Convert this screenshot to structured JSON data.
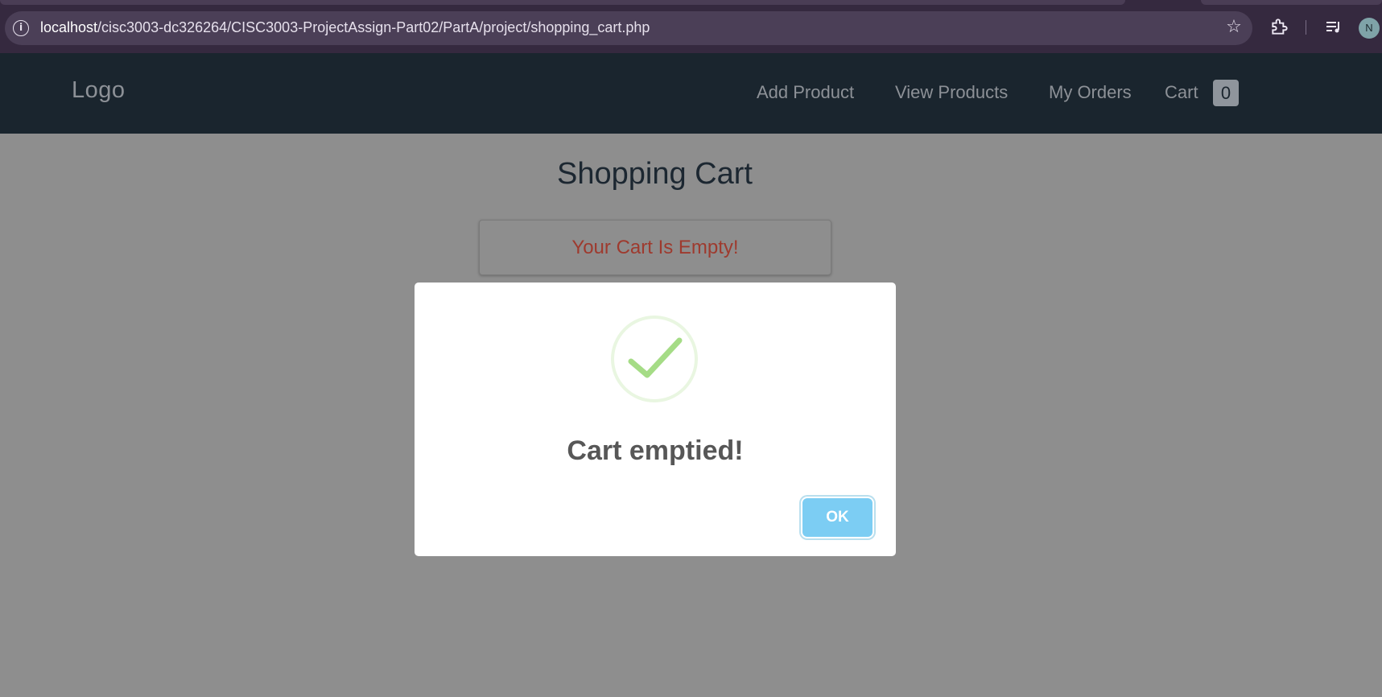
{
  "browser": {
    "url_host": "localhost",
    "url_path": "/cisc3003-dc326264/CISC3003-ProjectAssign-Part02/PartA/project/shopping_cart.php",
    "profile_initial": "N"
  },
  "navbar": {
    "logo": "Logo",
    "links": [
      "Add Product",
      "View Products",
      "My Orders",
      "Cart"
    ],
    "cart_count": "0"
  },
  "page": {
    "title": "Shopping Cart",
    "empty_message": "Your Cart Is Empty!"
  },
  "modal": {
    "title": "Cart emptied!",
    "ok_label": "OK",
    "icon": "success-check-icon"
  },
  "colors": {
    "navbar_bg": "#1a252e",
    "overlay_bg": "#8e8e8e",
    "empty_text": "#9e3a2e",
    "ok_button": "#7ccdf3",
    "check_green": "#a5dc86"
  }
}
